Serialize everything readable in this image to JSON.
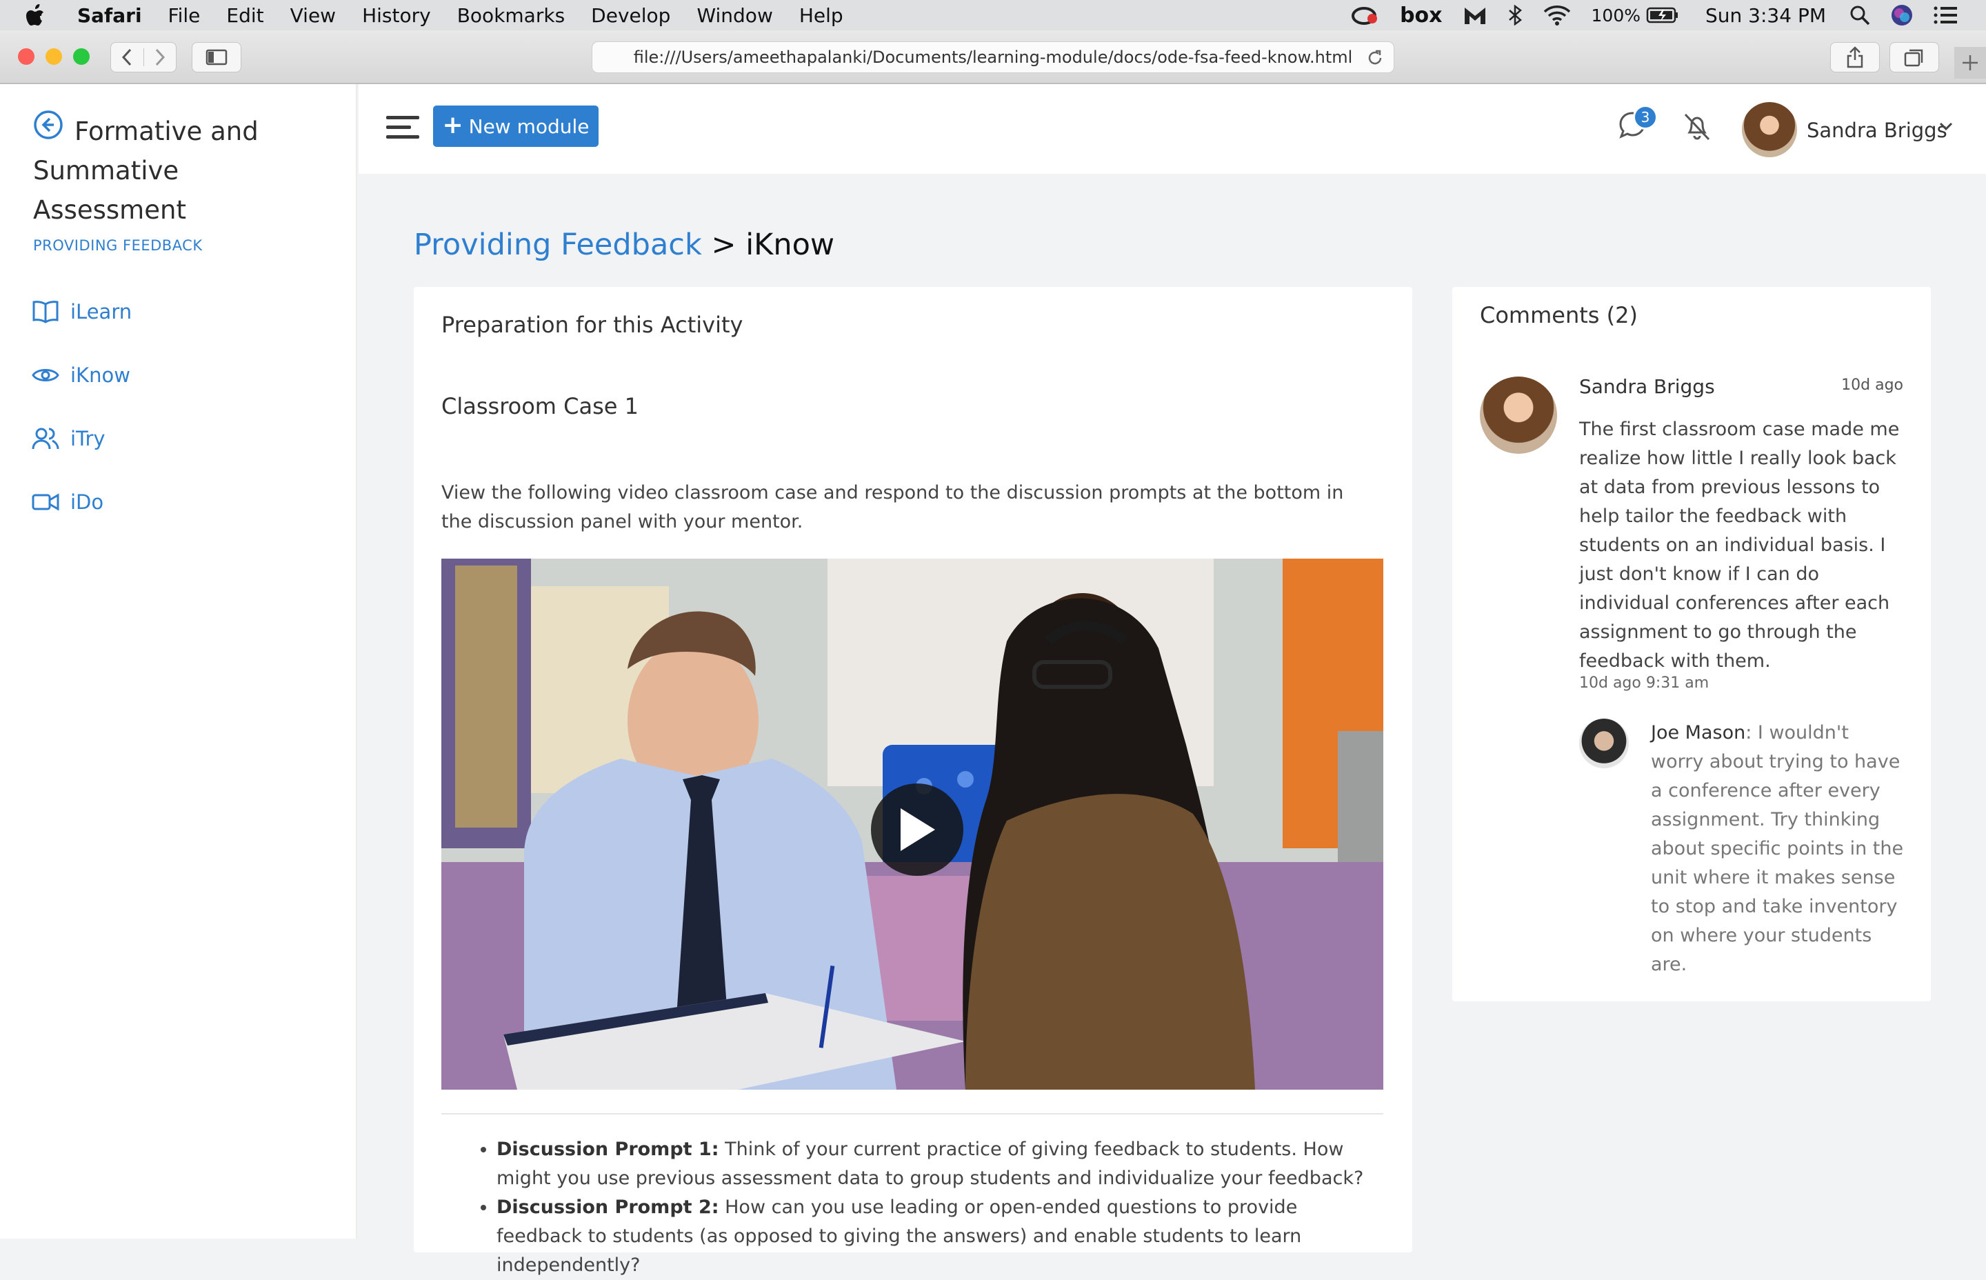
{
  "menubar": {
    "app": "Safari",
    "items": [
      "File",
      "Edit",
      "View",
      "History",
      "Bookmarks",
      "Develop",
      "Window",
      "Help"
    ],
    "battery": "100%",
    "clock": "Sun 3:34 PM",
    "box_label": "box"
  },
  "browser": {
    "url": "file:///Users/ameethapalanki/Documents/learning-module/docs/ode-fsa-feed-know.html"
  },
  "sidebar": {
    "course_title": "Formative and Summative Assessment",
    "section_label": "PROVIDING FEEDBACK",
    "items": [
      {
        "label": "iLearn",
        "icon": "book-icon"
      },
      {
        "label": "iKnow",
        "icon": "eye-icon"
      },
      {
        "label": "iTry",
        "icon": "users-icon"
      },
      {
        "label": "iDo",
        "icon": "video-camera-icon"
      }
    ]
  },
  "header": {
    "new_module_label": "New module",
    "chat_badge_count": "3",
    "user_name": "Sandra Briggs"
  },
  "breadcrumb": {
    "parent": "Providing Feedback",
    "separator": " > ",
    "current": "iKnow"
  },
  "main": {
    "prep_heading": "Preparation for this Activity",
    "case_heading": "Classroom Case 1",
    "intro": "View the following video classroom case and respond to the discussion prompts at the bottom in the discussion panel with your mentor.",
    "prompts": [
      {
        "label": "Discussion Prompt 1:",
        "text": " Think of your current practice of giving feedback to students. How might you use previous assessment data to group students and individualize your feedback?"
      },
      {
        "label": "Discussion Prompt 2:",
        "text": " How can you use leading or open-ended questions to provide feedback to students (as opposed to giving the answers) and enable students to learn independently?"
      }
    ]
  },
  "comments": {
    "title": "Comments (2)",
    "first": {
      "author": "Sandra Briggs",
      "age": "10d ago",
      "text": "The first classroom case made me realize how little I really look back at data from previous lessons to help tailor the feedback with students on an individual basis. I just don't know if I can do individual conferences after each assignment to go through the feedback with them.",
      "stamp": "10d ago 9:31 am"
    },
    "reply": {
      "author": "Joe Mason",
      "text": ": I wouldn't worry about trying to have a conference after every assignment. Try thinking about specific points in the unit where it makes sense to stop and take inventory on where your students are."
    }
  },
  "colors": {
    "accent": "#2f7fd1",
    "page_bg": "#f2f3f5"
  }
}
